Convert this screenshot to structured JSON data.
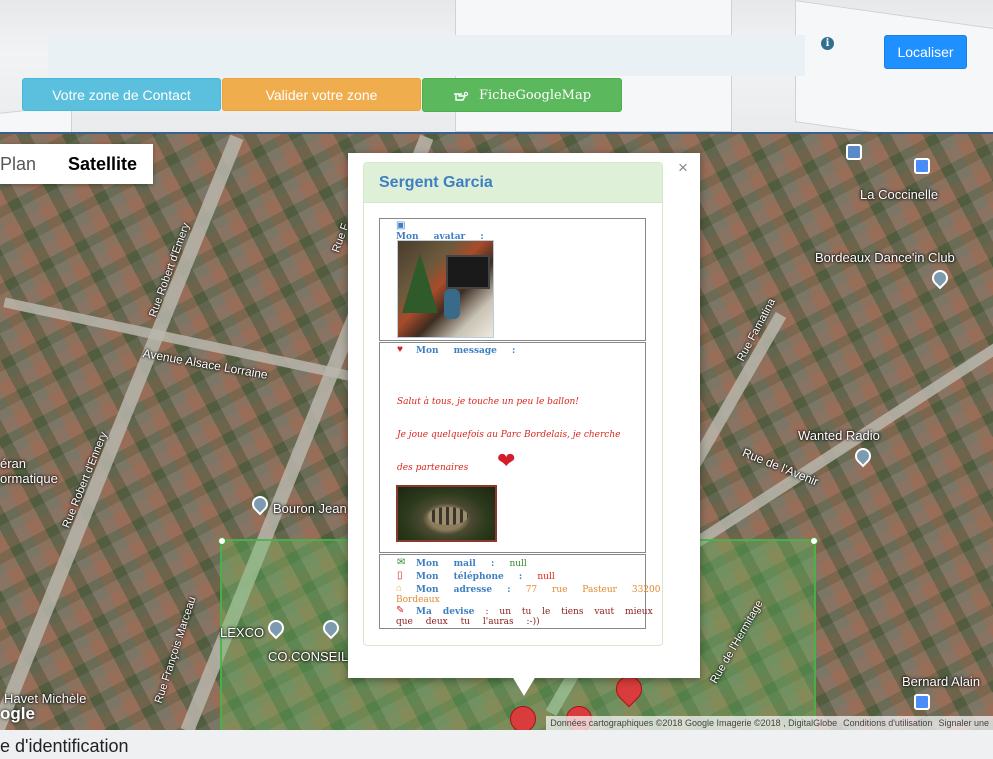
{
  "header": {
    "search_value": "",
    "info_icon": "i",
    "localiser_label": "Localiser"
  },
  "toolbar": {
    "contact_label": "Votre zone de Contact",
    "valider_label": "Valider votre zone",
    "fiche_label": "FicheGoogleMap",
    "fiche_icon": "hand-pointer-icon"
  },
  "map": {
    "type_plan": "Plan",
    "type_satellite": "Satellite",
    "labels": {
      "la_coccinelle": "La Coccinelle",
      "dance_club": "Bordeaux Dance'in Club",
      "wanted_radio": "Wanted Radio",
      "rue_avenir": "Rue de l'Avenir",
      "rue_famatina": "Rue Famatina",
      "rue_robert_emery_1": "Rue Robert d'Emery",
      "rue_robert_emery_2": "Rue Robert d'Ennery",
      "avenue_alsace": "Avenue Alsace Lorraine",
      "rue_f": "Rue F",
      "eran": "éran",
      "ormatique": "ormatique",
      "bouron": "Bouron Jean",
      "lexco": "LEXCO",
      "co_conseils": "CO.CONSEILS",
      "rue_francois_marceau": "Rue François Marceau",
      "rue_hermitage": "Rue de l'Hermitage",
      "havet": "Havet Michèle",
      "bernard_alain": "Bernard Alain"
    },
    "google_logo": "ogle",
    "attribution": {
      "data": "Données cartographiques ©2018 Google Imagerie ©2018 , DigitalGlobe",
      "terms": "Conditions d'utilisation",
      "report": "Signaler une"
    }
  },
  "info_window": {
    "close": "×",
    "name": "Sergent Garcia",
    "avatar_label": "Mon avatar :",
    "message_label": "Mon message :",
    "message_line1": "Salut à tous, je touche un peu le ballon!",
    "message_line2": "Je joue quelquefois au Parc Bordelais, je cherche",
    "message_line3": "des partenaires",
    "mail_label": "Mon mail :",
    "mail_value": "null",
    "phone_label": "Mon téléphone :",
    "phone_value": "null",
    "address_label": "Mon adresse :",
    "address_value_1": "77 rue Pasteur 33200",
    "address_value_2": "Bordeaux",
    "devise_label": "Ma devise",
    "devise_value_1": ": un tu le tiens vaut mieux",
    "devise_value_2": "que deux tu l'auras :-))"
  },
  "footer": {
    "text": "e d'identification"
  },
  "colors": {
    "localiser": "#1e90ff",
    "contact": "#5bc0de",
    "valider": "#f0ad4e",
    "fiche": "#5cb85c",
    "panel_title": "#3e7fc1",
    "message_red": "#d9261c"
  }
}
